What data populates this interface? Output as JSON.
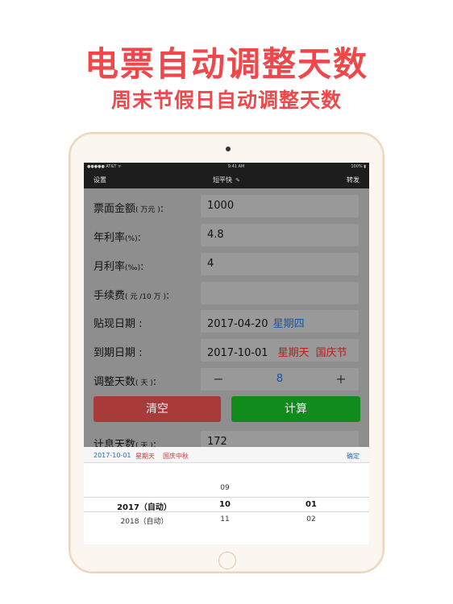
{
  "headline": "电票自动调整天数",
  "subheadline": "周末节假日自动调整天数",
  "statusbar": {
    "carrier": "●●●●● AT&T ᯤ",
    "time": "9:41 AM",
    "battery": "100% ▮"
  },
  "navbar": {
    "left": "设置",
    "title": "短平快",
    "right": "转发"
  },
  "form": {
    "face_amount": {
      "label": "票面金额",
      "unit": "( 万元 )",
      "colon": ":",
      "value": "1000"
    },
    "annual_rate": {
      "label": "年利率",
      "unit": "(%)",
      "colon": ":",
      "value": "4.8"
    },
    "monthly_rate": {
      "label": "月利率",
      "unit": "(‰)",
      "colon": ":",
      "value": "4"
    },
    "fee": {
      "label": "手续费",
      "unit": "( 元 /10 万 )",
      "colon": ":",
      "value": ""
    },
    "discount_date": {
      "label": "贴现日期",
      "colon": ":",
      "date": "2017-04-20",
      "weekday": "星期四"
    },
    "due_date": {
      "label": "到期日期",
      "colon": ":",
      "date": "2017-10-01",
      "weekday": "星期天",
      "holiday": "国庆节"
    },
    "adjust_days": {
      "label": "调整天数",
      "unit": "( 天 )",
      "colon": ":",
      "minus": "−",
      "value": "8",
      "plus": "+"
    },
    "interest_days": {
      "label": "计息天数",
      "unit": "( 天 )",
      "colon": ":",
      "value": "172"
    }
  },
  "buttons": {
    "clear": "清空",
    "calculate": "计算"
  },
  "picker": {
    "bar_date": "2017-10-01",
    "bar_weekday": "星期天",
    "bar_holiday": "国庆中秋",
    "confirm": "确定",
    "month_above": "09",
    "year_selected": "2017（自动）",
    "month_selected": "10",
    "day_selected": "01",
    "year_below": "2018（自动）",
    "month_below": "11",
    "day_below": "02"
  },
  "colors": {
    "accent_red": "#f0474b",
    "clear_button": "#a83a3a",
    "calc_button": "#118c1c",
    "link_blue": "#1a6fd0"
  }
}
